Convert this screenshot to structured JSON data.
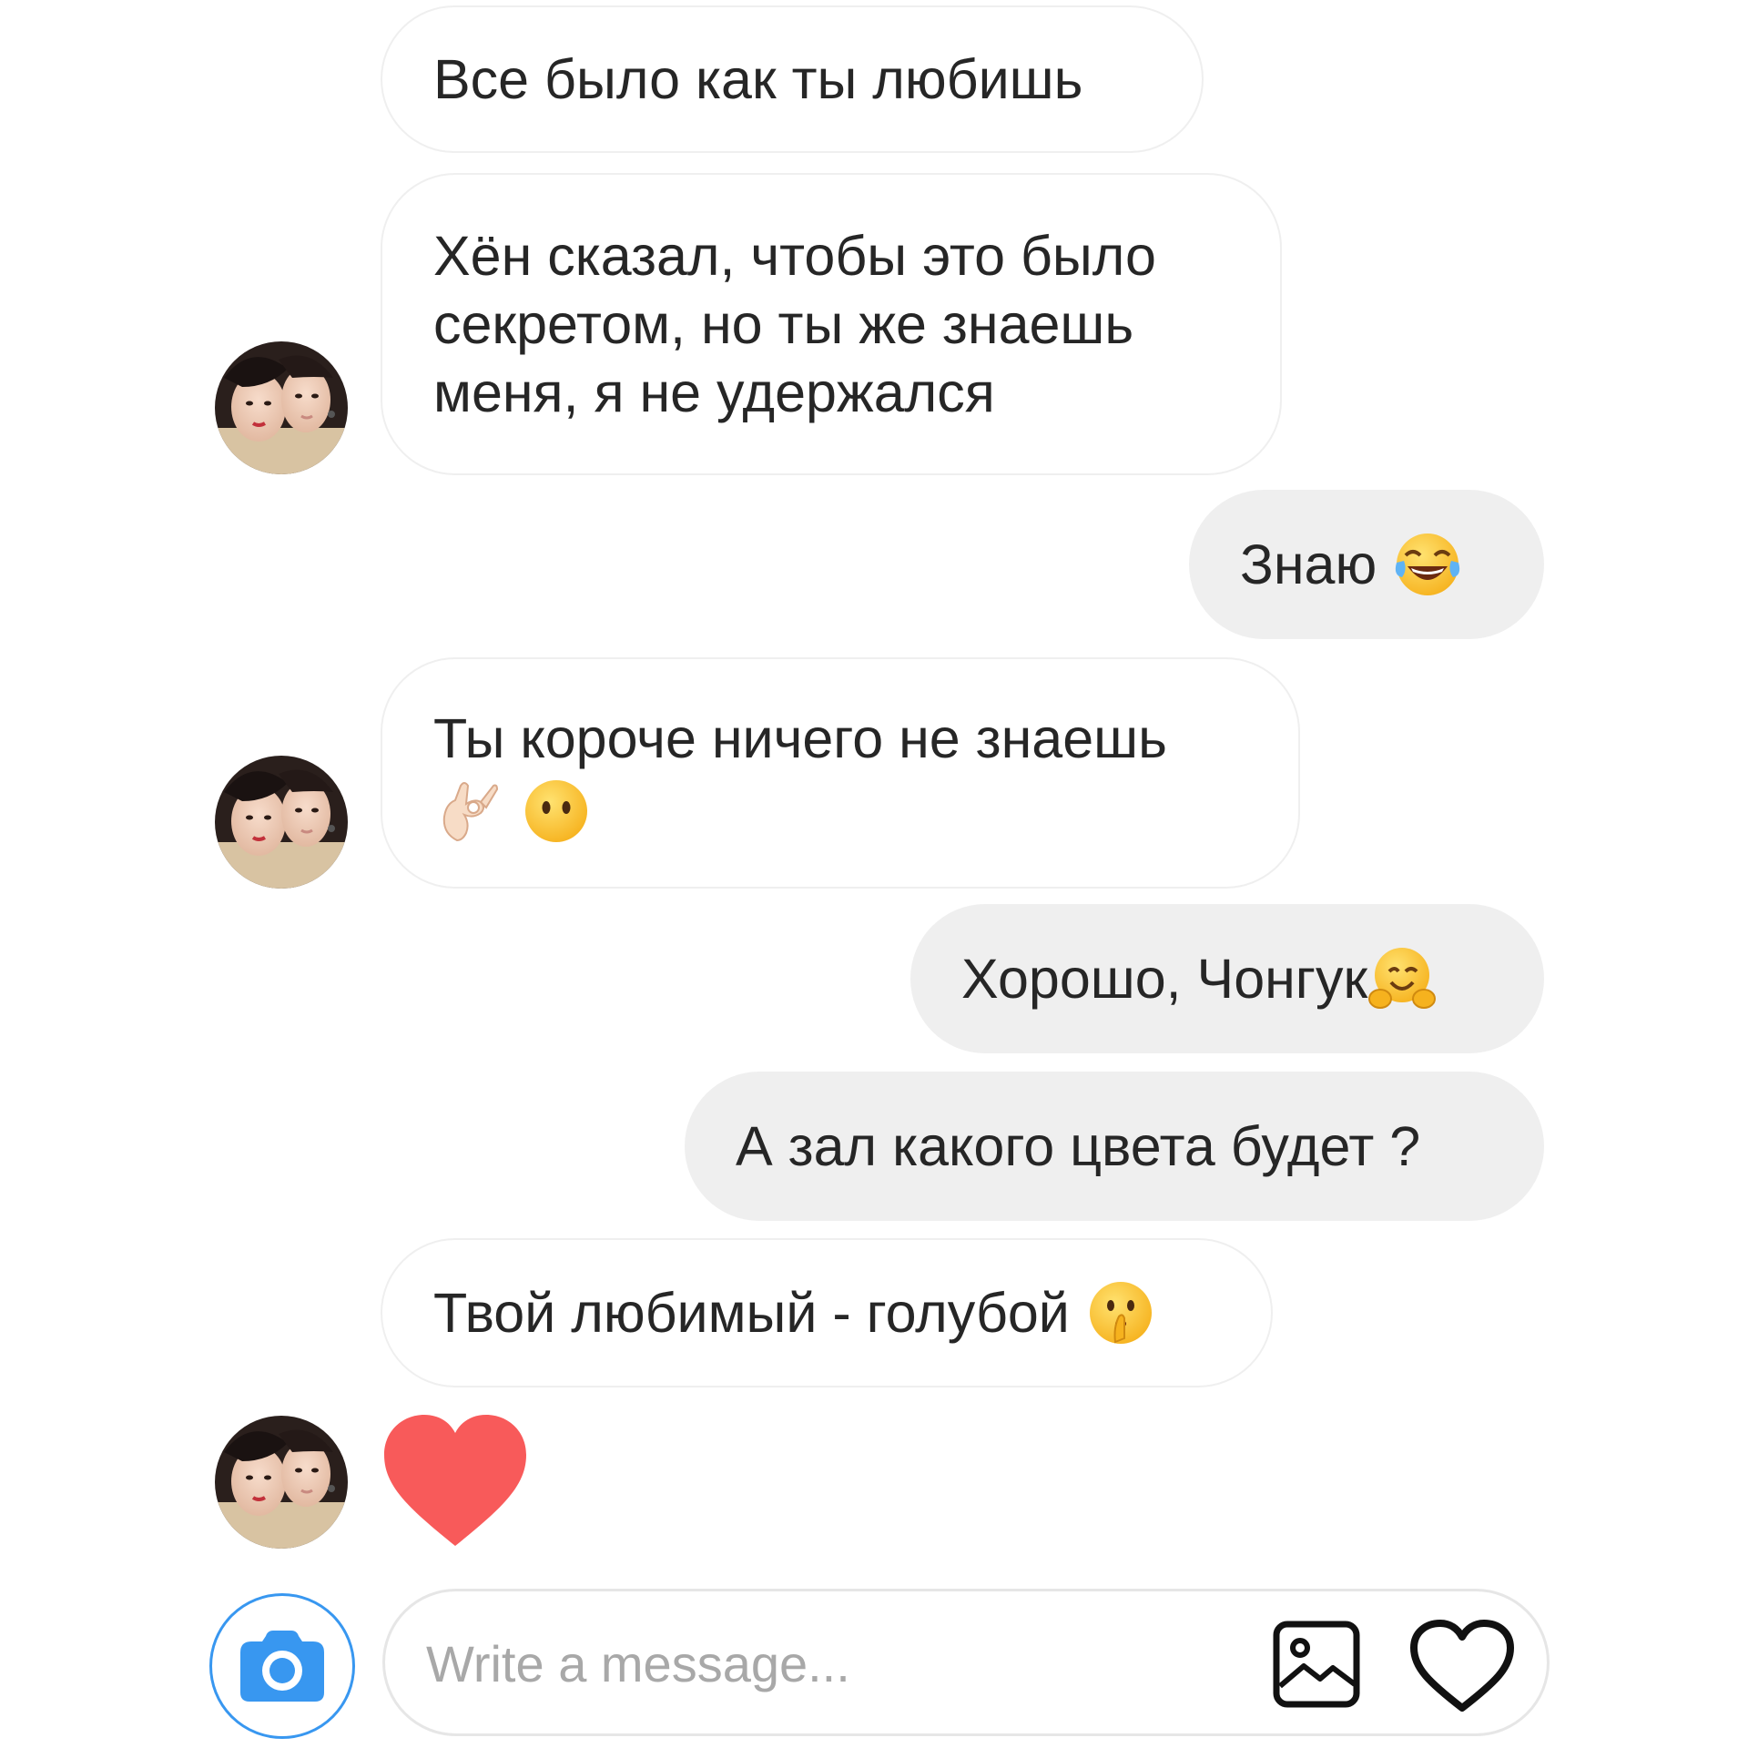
{
  "messages": [
    {
      "side": "in",
      "text": "Все было как ты любишь"
    },
    {
      "side": "in",
      "text": "Хён сказал, чтобы это было\nсекретом, но ты же знаешь\nменя, я не удержался"
    },
    {
      "side": "out",
      "text": "Знаю",
      "emoji": "face-with-tears-of-joy"
    },
    {
      "side": "in",
      "text": "Ты короче ничего не знаешь",
      "emoji": "ok-hand + face-without-mouth"
    },
    {
      "side": "out",
      "text": "Хорошо, Чонгук",
      "emoji": "hugging-face"
    },
    {
      "side": "out",
      "text": "А зал какого цвета будет ?"
    },
    {
      "side": "in",
      "text": "Твой любимый - голубой",
      "emoji": "shushing-face"
    },
    {
      "side": "in",
      "sticker": "red-heart"
    }
  ],
  "composer": {
    "placeholder": "Write a message...",
    "value": "",
    "camera_icon": "camera-icon",
    "gallery_icon": "image-icon",
    "like_icon": "heart-outline-icon"
  },
  "colors": {
    "accent": "#3897f0",
    "outgoing_bubble": "#efefef",
    "incoming_border": "#efefef",
    "heart": "#f85a5a",
    "text": "#262626",
    "placeholder": "#a8a8a8"
  }
}
